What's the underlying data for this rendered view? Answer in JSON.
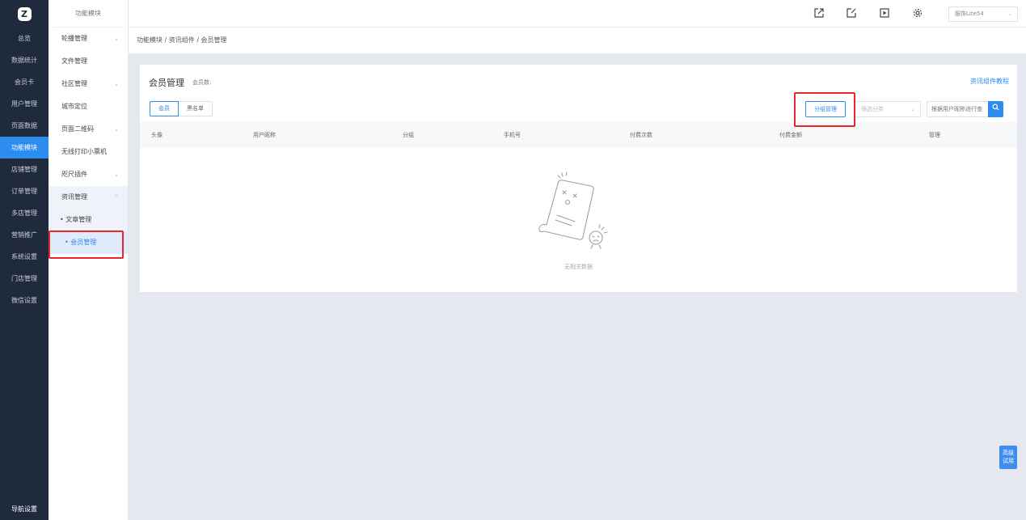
{
  "nav": {
    "logo": "Z",
    "items": [
      "总览",
      "数据统计",
      "会员卡",
      "用户管理",
      "页面数据",
      "功能模块",
      "店铺管理",
      "订单管理",
      "多店管理",
      "营销推广",
      "系统设置",
      "门店管理",
      "微信设置"
    ],
    "active_index": 5,
    "bottom": "导航设置"
  },
  "subnav": {
    "title": "功能模块",
    "items": [
      {
        "label": "轮播管理",
        "chev": "⌄"
      },
      {
        "label": "文件管理",
        "chev": ""
      },
      {
        "label": "社区管理",
        "chev": "⌄"
      },
      {
        "label": "城市定位",
        "chev": ""
      },
      {
        "label": "页面二维码",
        "chev": "⌄"
      },
      {
        "label": "无线打印小票机",
        "chev": ""
      },
      {
        "label": "咫尺插件",
        "chev": "⌄"
      },
      {
        "label": "资讯管理",
        "chev": "⌃"
      },
      {
        "label": "• 文章管理",
        "chev": ""
      },
      {
        "label": "• 会员管理",
        "chev": ""
      }
    ]
  },
  "topbar": {
    "store": "服饰Lite54"
  },
  "breadcrumb": "功能模块 / 资讯组件 / 会员管理",
  "card": {
    "title": "会员管理",
    "count_label": "会员数:",
    "help_link": "资讯组件教程",
    "tabs": [
      "会员",
      "黑名单"
    ],
    "group_btn": "分组管理",
    "filter_placeholder": "筛选分类",
    "search_placeholder": "根据用户昵称进行查",
    "columns": [
      "头像",
      "用户昵称",
      "分组",
      "手机号",
      "付费次数",
      "付费金额",
      "管理"
    ],
    "empty_text": "无相关数据"
  },
  "trial": {
    "line1": "高级",
    "line2": "试用"
  },
  "colors": {
    "accent": "#2c8cf0",
    "nav_bg": "#1f2a3d",
    "highlight": "#e8262b"
  }
}
